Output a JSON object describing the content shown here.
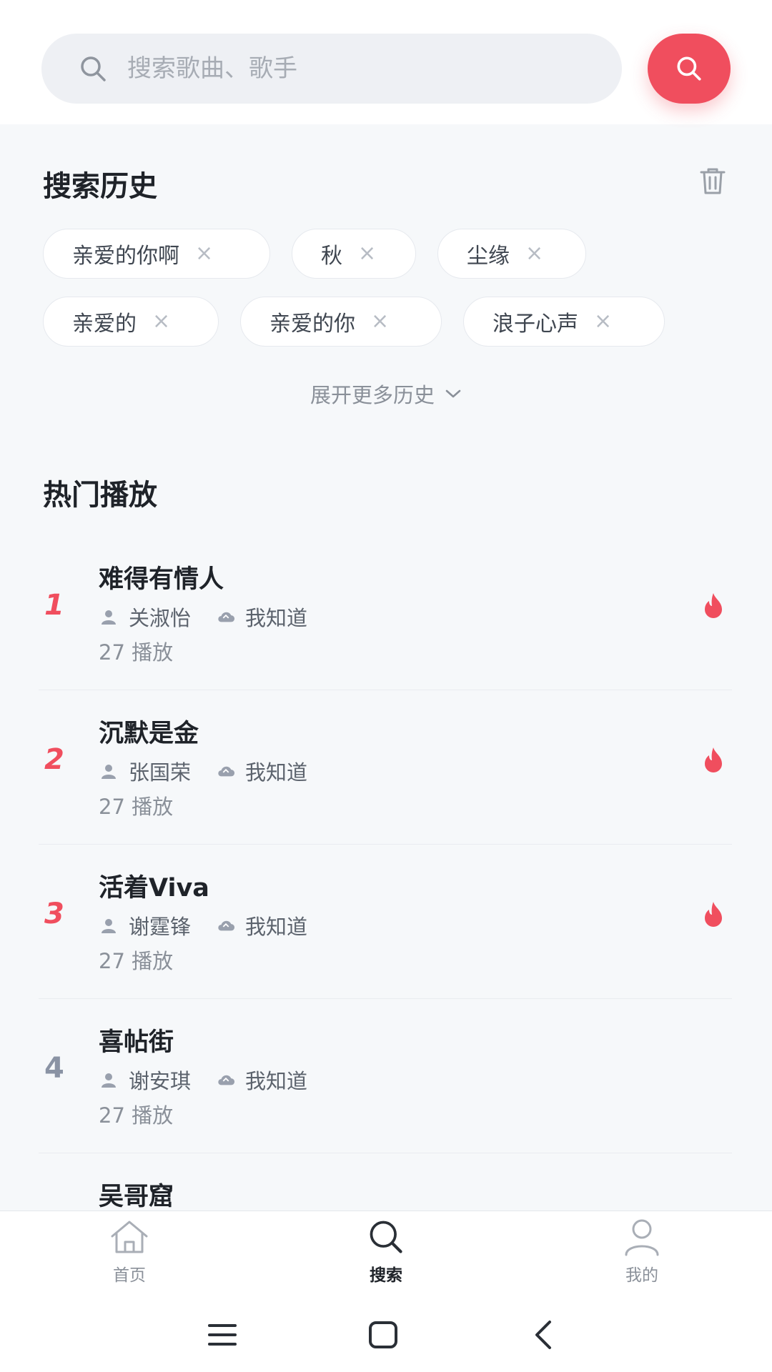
{
  "search": {
    "placeholder": "搜索歌曲、歌手"
  },
  "history": {
    "title": "搜索历史",
    "chips": [
      {
        "label": "亲爱的你啊"
      },
      {
        "label": "秋"
      },
      {
        "label": "尘缘"
      },
      {
        "label": "亲爱的"
      },
      {
        "label": "亲爱的你"
      },
      {
        "label": "浪子心声"
      }
    ],
    "remove_glyph": "×",
    "expand_label": "展开更多历史"
  },
  "hot": {
    "title": "热门播放",
    "items": [
      {
        "rank": "1",
        "title": "难得有情人",
        "artist": "关淑怡",
        "album": "我知道",
        "plays": "27 播放",
        "hot": true
      },
      {
        "rank": "2",
        "title": "沉默是金",
        "artist": "张国荣",
        "album": "我知道",
        "plays": "27 播放",
        "hot": true
      },
      {
        "rank": "3",
        "title": "活着Viva",
        "artist": "谢霆锋",
        "album": "我知道",
        "plays": "27 播放",
        "hot": true
      },
      {
        "rank": "4",
        "title": "喜帖街",
        "artist": "谢安琪",
        "album": "我知道",
        "plays": "27 播放",
        "hot": false
      },
      {
        "rank": "",
        "title": "吴哥窟",
        "artist": "",
        "album": "",
        "plays": "",
        "hot": false
      }
    ]
  },
  "tabbar": {
    "items": [
      {
        "label": "首页",
        "icon": "home-icon",
        "active": false
      },
      {
        "label": "搜索",
        "icon": "search-icon",
        "active": true
      },
      {
        "label": "我的",
        "icon": "user-icon",
        "active": false
      }
    ]
  },
  "colors": {
    "accent": "#f04e5e",
    "background": "#f6f8fa",
    "chip_background": "#ffffff",
    "text_primary": "#1f2329",
    "text_secondary": "#8a9099"
  }
}
